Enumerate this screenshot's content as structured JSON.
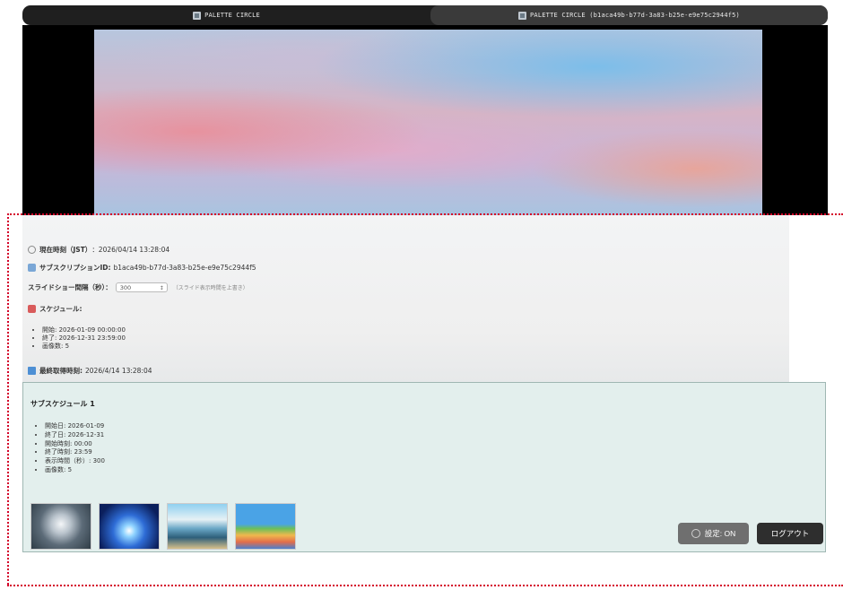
{
  "tabs": [
    {
      "label": "PALETTE CIRCLE"
    },
    {
      "label": "PALETTE CIRCLE (b1aca49b-b77d-3a83-b25e-e9e75c2944f5)"
    }
  ],
  "info": {
    "current_time_label": "現在時刻（JST）",
    "current_time_value": "：2026/04/14 13:28:04",
    "subscription_label": "サブスクリプションID:",
    "subscription_value": "b1aca49b-b77d-3a83-b25e-e9e75c2944f5",
    "slideshow_label": "スライドショー間隔（秒）：",
    "slideshow_value": "300",
    "slideshow_hint": "（スライド表示時間を上書き）",
    "schedule_label": "スケジュール:",
    "schedule_items": [
      "開始: 2026-01-09 00:00:00",
      "終了: 2026-12-31 23:59:00",
      "画像数: 5"
    ],
    "last_fetch_label": "最終取得時刻:",
    "last_fetch_value": "2026/4/14 13:28:04"
  },
  "schedule_panel": {
    "title": "サブスケジュール 1",
    "items": [
      "開始日: 2026-01-09",
      "終了日: 2026-12-31",
      "開始時刻: 00:00",
      "終了時刻: 23:59",
      "表示時間（秒）: 300",
      "画像数: 5"
    ]
  },
  "buttons": {
    "settings": "設定: ON",
    "logout": "ログアウト"
  },
  "icons": {
    "tab": "app-icon",
    "clock": "clock-icon",
    "subscription": "document-icon",
    "schedule": "calendar-icon",
    "last_fetch": "save-icon",
    "settings": "gear-icon"
  },
  "colors": {
    "selection_outline": "#d4002a",
    "schedule_bg": "#e3efed"
  }
}
